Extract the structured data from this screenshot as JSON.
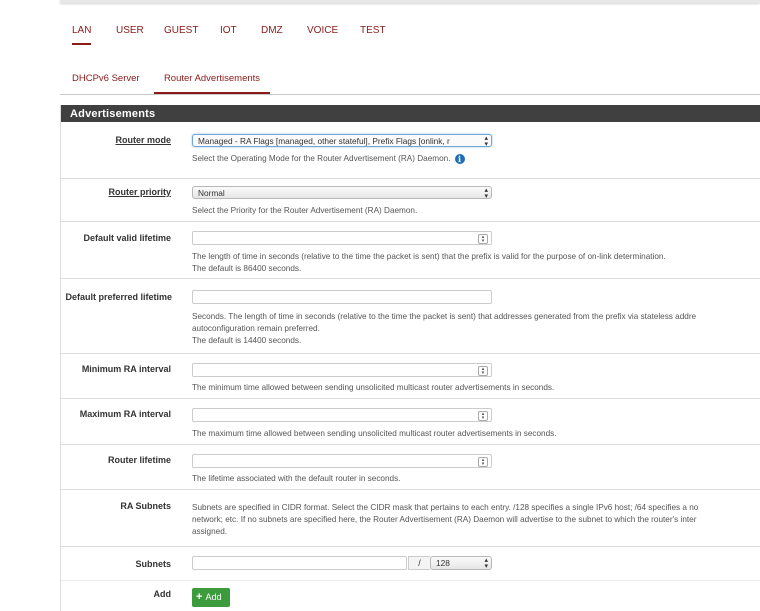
{
  "tabs": [
    "LAN",
    "USER",
    "GUEST",
    "IOT",
    "DMZ",
    "VOICE",
    "TEST"
  ],
  "subtabs": [
    "DHCPv6 Server",
    "Router Advertisements"
  ],
  "panel": {
    "title": "Advertisements"
  },
  "fields": {
    "router_mode": {
      "label": "Router mode",
      "value": "Managed - RA Flags [managed, other stateful], Prefix Flags [onlink, r",
      "help": "Select the Operating Mode for the Router Advertisement (RA) Daemon."
    },
    "router_priority": {
      "label": "Router priority",
      "value": "Normal",
      "help": "Select the Priority for the Router Advertisement (RA) Daemon."
    },
    "default_valid_lifetime": {
      "label": "Default valid lifetime",
      "value": "",
      "help1": "The length of time in seconds (relative to the time the packet is sent) that the prefix is valid for the purpose of on-link determination.",
      "help2": "The default is 86400 seconds."
    },
    "default_preferred_lifetime": {
      "label": "Default preferred lifetime",
      "value": "",
      "help1": "Seconds. The length of time in seconds (relative to the time the packet is sent) that addresses generated from the prefix via stateless addre",
      "help2": "autoconfiguration remain preferred.",
      "help3": "The default is 14400 seconds."
    },
    "min_ra_interval": {
      "label": "Minimum RA interval",
      "value": "",
      "help": "The minimum time allowed between sending unsolicited multicast router advertisements in seconds."
    },
    "max_ra_interval": {
      "label": "Maximum RA interval",
      "value": "",
      "help": "The maximum time allowed between sending unsolicited multicast router advertisements in seconds."
    },
    "router_lifetime": {
      "label": "Router lifetime",
      "value": "",
      "help": "The lifetime associated with the default router in seconds."
    },
    "ra_subnets": {
      "label": "RA Subnets",
      "help1": "Subnets are specified in CIDR format. Select the CIDR mask that pertains to each entry. /128 specifies a single IPv6 host; /64 specifies a no",
      "help2": "network; etc. If no subnets are specified here, the Router Advertisement (RA) Daemon will advertise to the subnet to which the router's inter",
      "help3": "assigned."
    },
    "subnets": {
      "label": "Subnets",
      "value": "",
      "slash": "/",
      "mask": "128"
    },
    "add": {
      "label": "Add",
      "button": "Add"
    }
  },
  "icons": {
    "info": "info-icon",
    "plus": "plus-icon",
    "spinner": "spinner-icon",
    "select_arrows": "select-arrows-icon"
  },
  "colors": {
    "accent": "#8b1a1a",
    "header_bg": "#404040",
    "add_button": "#3c9b3c",
    "info": "#1f6fb4"
  }
}
